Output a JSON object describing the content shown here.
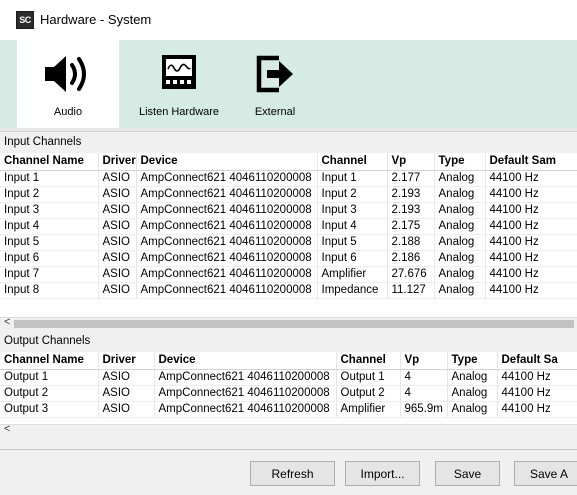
{
  "window": {
    "title": "Hardware - System",
    "app_icon_text": "SC"
  },
  "toolbar": {
    "items": [
      {
        "label": "Audio",
        "icon": "speaker-icon",
        "active": true
      },
      {
        "label": "Listen Hardware",
        "icon": "monitor-waveform-icon",
        "active": false
      },
      {
        "label": "External",
        "icon": "external-arrow-icon",
        "active": false
      }
    ]
  },
  "input_channels": {
    "title": "Input Channels",
    "columns": [
      "Channel Name",
      "Driver",
      "Device",
      "Channel",
      "Vp",
      "Type",
      "Default Sam"
    ],
    "rows": [
      [
        "Input 1",
        "ASIO",
        "AmpConnect621 4046110200008",
        "Input 1",
        "2.177",
        "Analog",
        "44100 Hz"
      ],
      [
        "Input 2",
        "ASIO",
        "AmpConnect621 4046110200008",
        "Input 2",
        "2.193",
        "Analog",
        "44100 Hz"
      ],
      [
        "Input 3",
        "ASIO",
        "AmpConnect621 4046110200008",
        "Input 3",
        "2.193",
        "Analog",
        "44100 Hz"
      ],
      [
        "Input 4",
        "ASIO",
        "AmpConnect621 4046110200008",
        "Input 4",
        "2.175",
        "Analog",
        "44100 Hz"
      ],
      [
        "Input 5",
        "ASIO",
        "AmpConnect621 4046110200008",
        "Input 5",
        "2.188",
        "Analog",
        "44100 Hz"
      ],
      [
        "Input 6",
        "ASIO",
        "AmpConnect621 4046110200008",
        "Input 6",
        "2.186",
        "Analog",
        "44100 Hz"
      ],
      [
        "Input 7",
        "ASIO",
        "AmpConnect621 4046110200008",
        "Amplifier",
        "27.676",
        "Analog",
        "44100 Hz"
      ],
      [
        "Input 8",
        "ASIO",
        "AmpConnect621 4046110200008",
        "Impedance",
        "11.127",
        "Analog",
        "44100 Hz"
      ]
    ]
  },
  "output_channels": {
    "title": "Output Channels",
    "columns": [
      "Channel Name",
      "Driver",
      "Device",
      "Channel",
      "Vp",
      "Type",
      "Default Sa"
    ],
    "rows": [
      [
        "Output 1",
        "ASIO",
        "AmpConnect621 4046110200008",
        "Output 1",
        "4",
        "Analog",
        "44100 Hz"
      ],
      [
        "Output 2",
        "ASIO",
        "AmpConnect621 4046110200008",
        "Output 2",
        "4",
        "Analog",
        "44100 Hz"
      ],
      [
        "Output 3",
        "ASIO",
        "AmpConnect621 4046110200008",
        "Amplifier",
        "965.9m",
        "Analog",
        "44100 Hz"
      ]
    ]
  },
  "scroll": {
    "left_arrow": "<"
  },
  "buttons": {
    "refresh": "Refresh",
    "import": "Import...",
    "save": "Save",
    "save_as": "Save A"
  },
  "colors": {
    "toolbar_bg": "#d5ebe4",
    "active_tool_bg": "#ffffff"
  }
}
